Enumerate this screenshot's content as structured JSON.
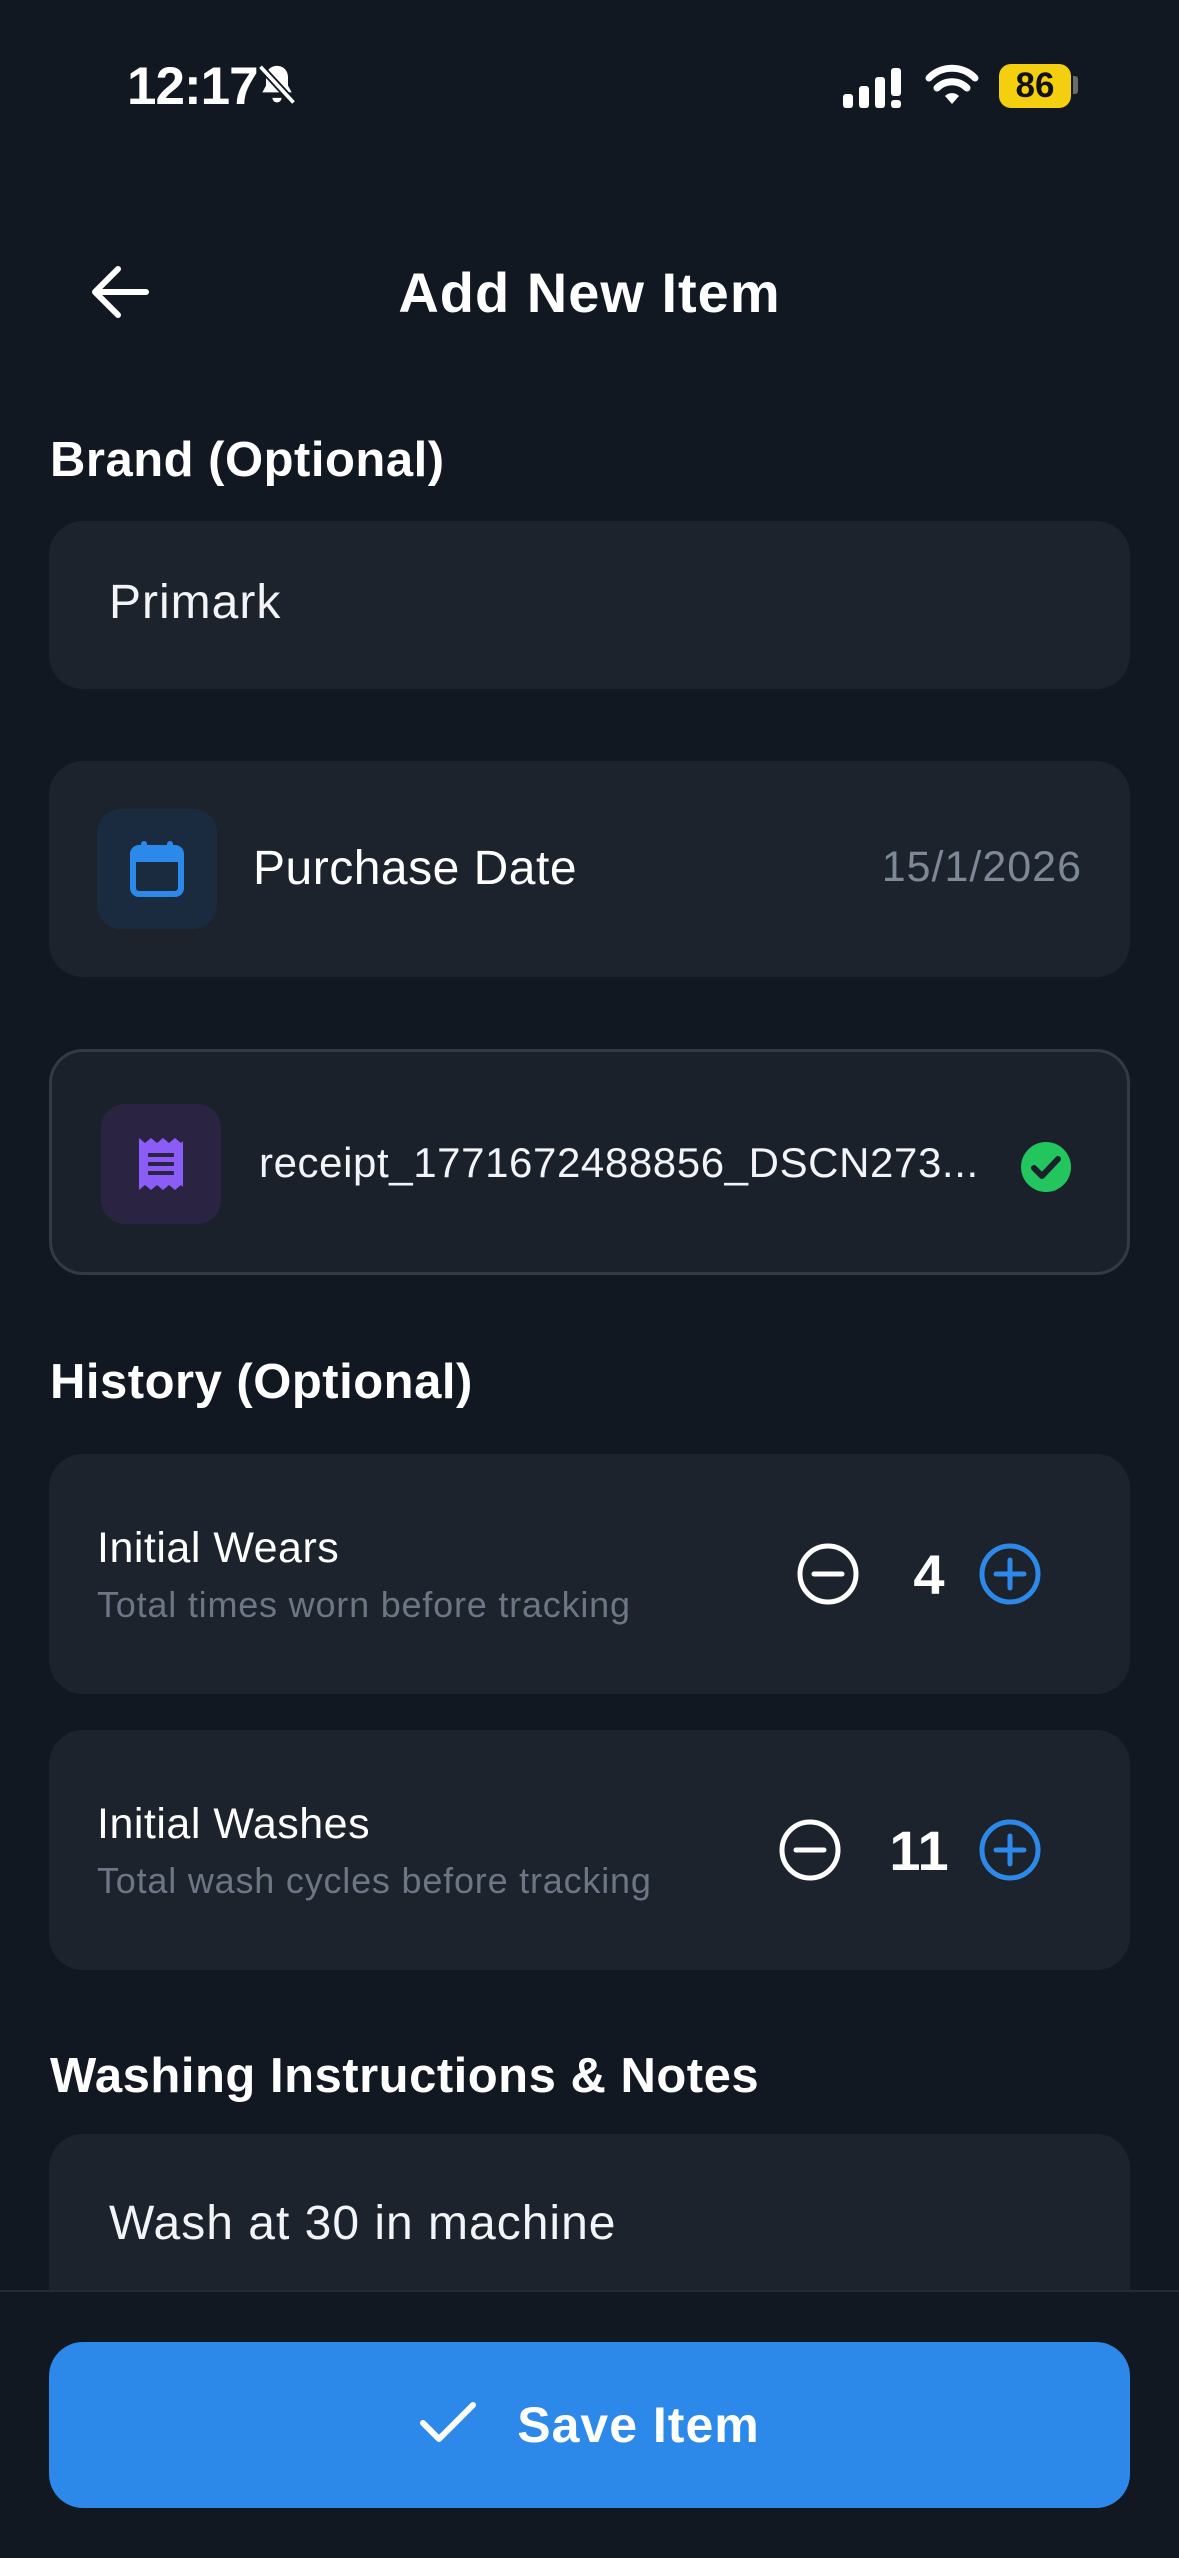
{
  "status_bar": {
    "time": "12:17",
    "battery": "86"
  },
  "header": {
    "title": "Add New Item"
  },
  "brand": {
    "label": "Brand (Optional)",
    "value": "Primark"
  },
  "purchase_date": {
    "label": "Purchase Date",
    "value": "15/1/2026"
  },
  "receipt": {
    "filename": "receipt_1771672488856_DSCN273..."
  },
  "history": {
    "label": "History (Optional)",
    "wears": {
      "title": "Initial Wears",
      "subtitle": "Total times worn before tracking",
      "count": "4"
    },
    "washes": {
      "title": "Initial Washes",
      "subtitle": "Total wash cycles before tracking",
      "count": "11"
    }
  },
  "notes": {
    "label": "Washing Instructions & Notes",
    "value": "Wash at 30 in machine"
  },
  "save_button": {
    "label": "Save Item"
  },
  "colors": {
    "background": "#111821",
    "card": "#1d232d",
    "accent_blue": "#2c89e9",
    "purple": "#8b5cf6",
    "success_green": "#22c55e",
    "battery_yellow": "#f4cf10"
  },
  "icons": [
    "bell-slash-icon",
    "signal-icon",
    "wifi-icon",
    "back-arrow-icon",
    "calendar-icon",
    "receipt-icon",
    "check-circle-icon",
    "minus-circle-icon",
    "plus-circle-icon",
    "checkmark-icon"
  ]
}
